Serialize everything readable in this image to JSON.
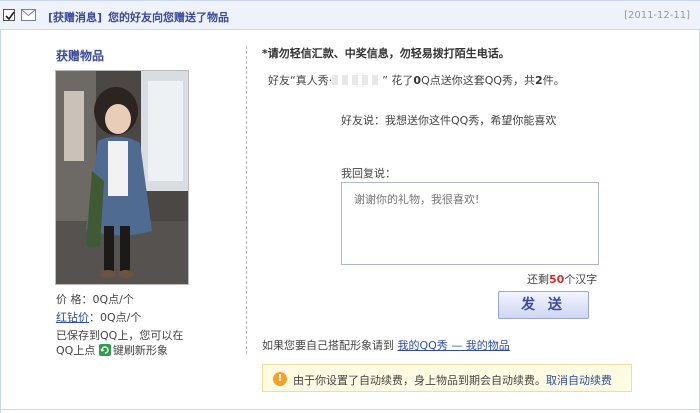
{
  "header": {
    "tag": "[获赠消息]",
    "title": "您的好友向您赠送了物品",
    "date": "[2011-12-11]"
  },
  "gift": {
    "title": "获赠物品",
    "price_label": "价 格：",
    "price_value": "0Q点/个",
    "red_label": "红钻价",
    "red_value": "：0Q点/个",
    "saved_text_1": "已保存到QQ上，您可以在",
    "saved_text_2": "QQ上点",
    "saved_text_3": "键刷新形象"
  },
  "message": {
    "warning": "*请勿轻信汇款、中奖信息，勿轻易拨打陌生电话。",
    "intro_pre": "好友“真人秀·",
    "intro_mid": "” 花了",
    "intro_qpoints": "0",
    "intro_after": "Q点送你这套QQ秀，共",
    "intro_count": "2",
    "intro_end": "件。",
    "friend_says": "好友说：我想送你这件QQ秀，希望你能喜欢",
    "reply_label": "我回复说：",
    "reply_placeholder": "谢谢你的礼物，我很喜欢!",
    "remain_pre": "还剩",
    "remain_num": "50",
    "remain_post": "个汉字",
    "send_label": "发 送",
    "own_show_pre": "如果您要自己搭配形象请到",
    "own_show_link": "我的QQ秀 — 我的物品",
    "notice_text": "由于你设置了自动续费，身上物品到期会自动续费。",
    "notice_link": "取消自动续费"
  },
  "colors": {
    "accent": "#3b4a9b",
    "link": "#2a4f9e",
    "highlight": "#d0302a",
    "notice_bg": "#fffbe3"
  }
}
